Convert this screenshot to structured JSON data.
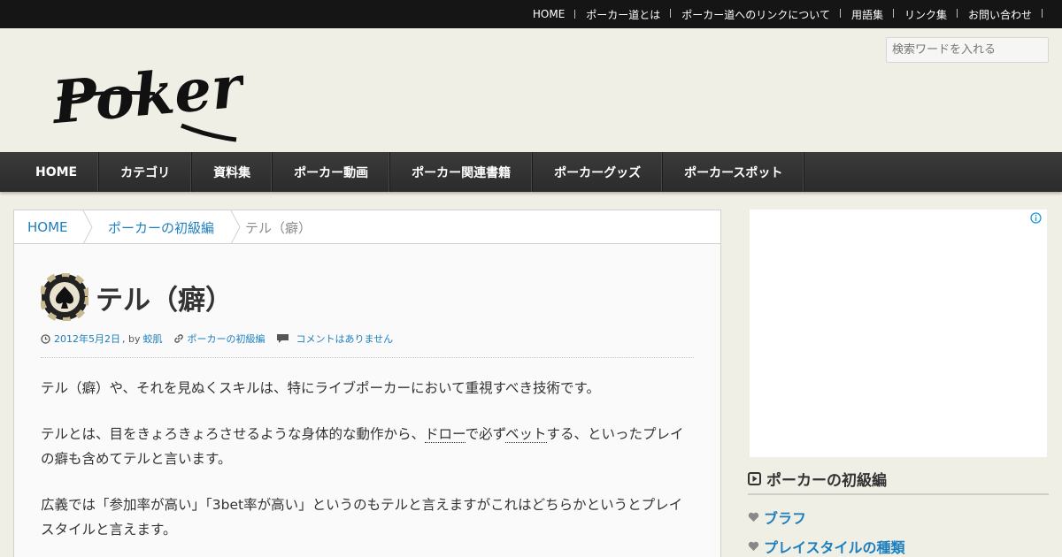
{
  "top_nav": [
    "HOME",
    "ポーカー道とは",
    "ポーカー道へのリンクについて",
    "用語集",
    "リンク集",
    "お問い合わせ"
  ],
  "header": {
    "logo_text": "Poker道",
    "search_placeholder": "検索ワードを入れる"
  },
  "main_nav": [
    "HOME",
    "カテゴリ",
    "資料集",
    "ポーカー動画",
    "ポーカー関連書籍",
    "ポーカーグッズ",
    "ポーカースポット"
  ],
  "breadcrumb": {
    "home": "HOME",
    "category": "ポーカーの初級編",
    "current": "テル（癖）"
  },
  "article": {
    "title": "テル（癖）",
    "date": "2012年5月2日",
    "by": ", by",
    "author": "蛟肌",
    "category": "ポーカーの初級編",
    "comments": "コメントはありません",
    "p1": "テル（癖）や、それを見ぬくスキルは、特にライブポーカーにおいて重視すべき技術です。",
    "p2_a": "テルとは、目をきょろきょろさせるような身体的な動作から、",
    "p2_link1": "ドロー",
    "p2_b": "で必ず",
    "p2_link2": "ベット",
    "p2_c": "する、といったプレイの癖も含めてテルと言います。",
    "p3": "広義では「参加率が高い」「3bet率が高い」というのもテルと言えますがこれはどちらかというとプレイスタイルと言えます。"
  },
  "sidebar": {
    "heading": "ポーカーの初級編",
    "items": [
      "ブラフ",
      "プレイスタイルの種類"
    ]
  },
  "colors": {
    "link": "#1e7fbf",
    "topbar": "#151515",
    "nav": "#333333",
    "background": "#f0efe5"
  }
}
